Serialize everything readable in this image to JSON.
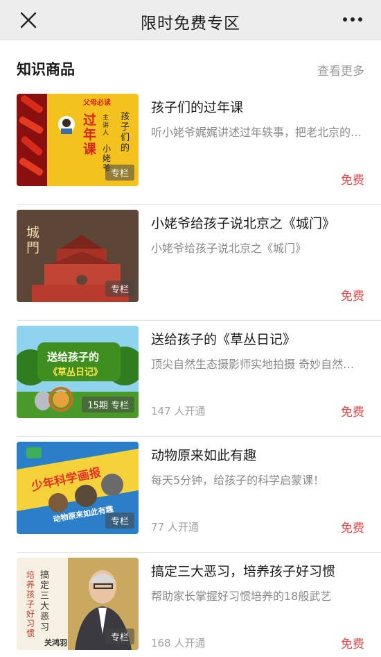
{
  "nav": {
    "title": "限时免费专区",
    "close_icon": "close-icon",
    "more_icon": "more-dots-icon"
  },
  "section": {
    "title": "知识商品",
    "see_more": "查看更多"
  },
  "colors": {
    "price_free": "#e64340",
    "nav_bg": "#ededed"
  },
  "items": [
    {
      "title": "孩子们的过年课",
      "desc": "听小姥爷娓娓讲述过年轶事，把老北京的年味儿带给孩子",
      "tag": "专栏",
      "subscribers": "",
      "price": "免费",
      "thumb_lines": [
        "父母必读",
        "孩子们的",
        "过年课",
        "主讲人",
        "小姥爷"
      ]
    },
    {
      "title": "小姥爷给孩子说北京之《城门》",
      "desc": "小姥爷给孩子说北京之《城门》",
      "tag": "专栏",
      "subscribers": "",
      "price": "免费",
      "thumb_lines": [
        "城門"
      ]
    },
    {
      "title": "送给孩子的《草丛日记》",
      "desc": "顶尖自然生态摄影师实地拍摄 奇妙自然世界",
      "tag": "15期 专栏",
      "subscribers": "147 人开通",
      "price": "免费",
      "thumb_lines": [
        "送给孩子的",
        "《草丛日记》"
      ]
    },
    {
      "title": "动物原来如此有趣",
      "desc": "每天5分钟，给孩子的科学启蒙课！",
      "tag": "专栏",
      "subscribers": "77 人开通",
      "price": "免费",
      "thumb_lines": [
        "少年科学画报",
        "动物原来如此有趣"
      ]
    },
    {
      "title": "搞定三大恶习，培养孩子好习惯",
      "desc": "帮助家长掌握好习惯培养的18般武艺",
      "tag": "专栏",
      "subscribers": "168 人开通",
      "price": "免费",
      "thumb_lines": [
        "搞定三大恶习",
        "培养孩子好习惯",
        "关鸿羽"
      ]
    }
  ]
}
